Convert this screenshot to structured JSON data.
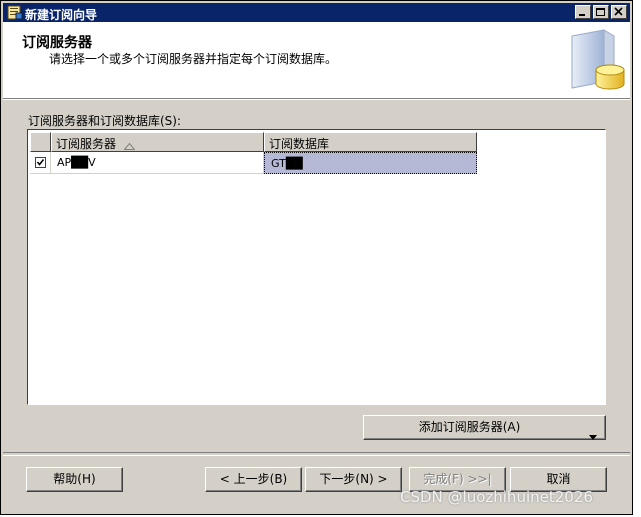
{
  "window": {
    "title": "新建订阅向导"
  },
  "header": {
    "title": "订阅服务器",
    "subtitle": "请选择一个或多个订阅服务器并指定每个订阅数据库。"
  },
  "grid": {
    "label": "订阅服务器和订阅数据库(S):",
    "columns": [
      "订阅服务器",
      "订阅数据库"
    ],
    "rows": [
      {
        "checked": true,
        "server": "AP██V",
        "database": "GT██"
      }
    ]
  },
  "buttons": {
    "add_subscriber": "添加订阅服务器(A)",
    "help": "帮助(H)",
    "back": "< 上一步(B)",
    "next": "下一步(N) >",
    "finish": "完成(F) >>|",
    "cancel": "取消"
  },
  "watermark": "CSDN @luozhihuinet2026",
  "colors": {
    "titlebar": "#0a246a",
    "dialog": "#d4d0c8",
    "selected_cell": "#b6b9d6"
  }
}
